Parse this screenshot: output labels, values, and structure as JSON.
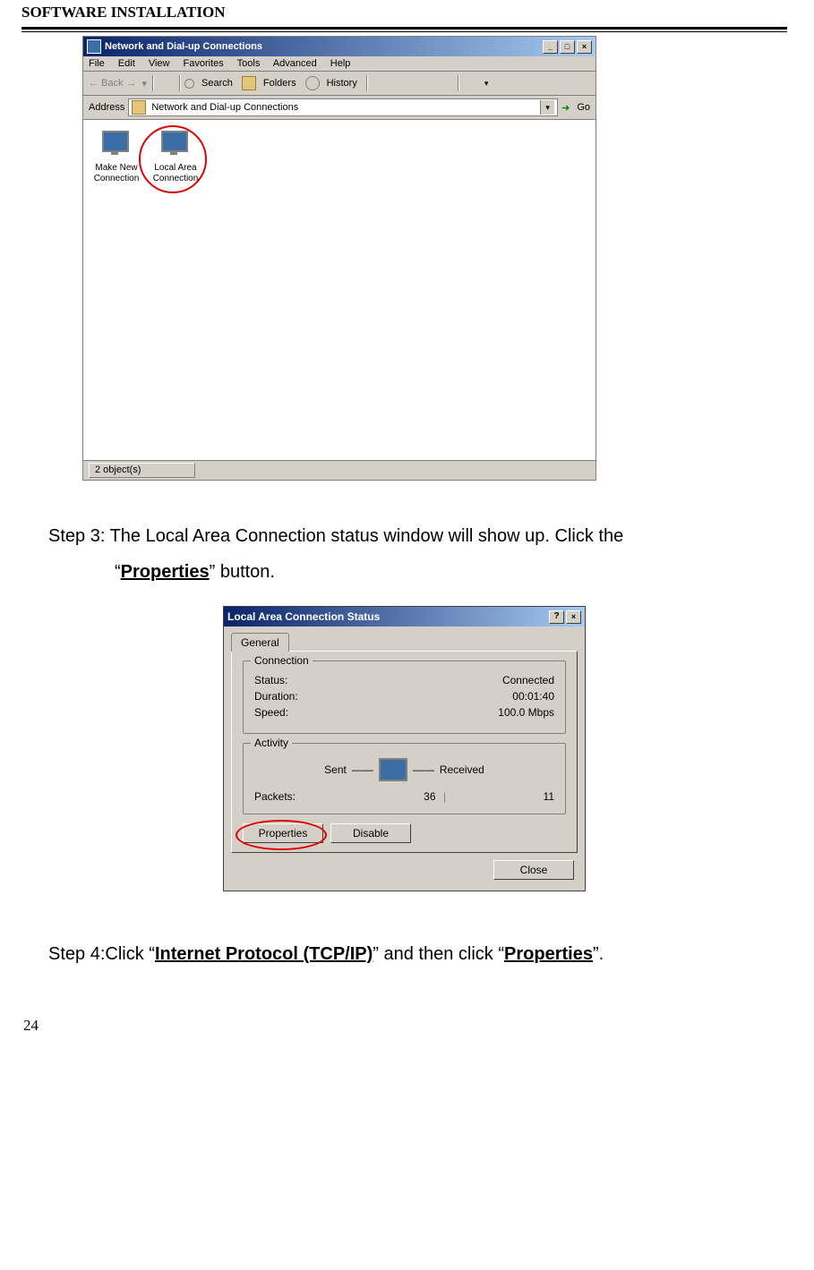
{
  "header": "SOFTWARE INSTALLATION",
  "page_number": "24",
  "step3": {
    "prefix": "Step 3: The Local Area Connection status window will show up. Click the",
    "line2a": "“",
    "keyword": "Properties",
    "line2b": "” button."
  },
  "step4": {
    "prefix": "Step 4:Click “",
    "kw1": "Internet Protocol (TCP/IP)",
    "mid": "” and then click “",
    "kw2": "Properties",
    "suffix": "”."
  },
  "shot1": {
    "title": "Network and Dial-up Connections",
    "menu": [
      "File",
      "Edit",
      "View",
      "Favorites",
      "Tools",
      "Advanced",
      "Help"
    ],
    "tool_search": "Search",
    "tool_folders": "Folders",
    "tool_history": "History",
    "address_label": "Address",
    "address_value": "Network and Dial-up Connections",
    "go": "Go",
    "icon1": "Make New Connection",
    "icon2": "Local Area Connection",
    "status": "2 object(s)"
  },
  "shot2": {
    "title": "Local Area Connection Status",
    "tab": "General",
    "group1": "Connection",
    "status_lbl": "Status:",
    "status_val": "Connected",
    "duration_lbl": "Duration:",
    "duration_val": "00:01:40",
    "speed_lbl": "Speed:",
    "speed_val": "100.0 Mbps",
    "group2": "Activity",
    "sent": "Sent",
    "received": "Received",
    "packets_lbl": "Packets:",
    "packets_sent": "36",
    "packets_recv": "11",
    "btn_props": "Properties",
    "btn_disable": "Disable",
    "btn_close": "Close"
  }
}
